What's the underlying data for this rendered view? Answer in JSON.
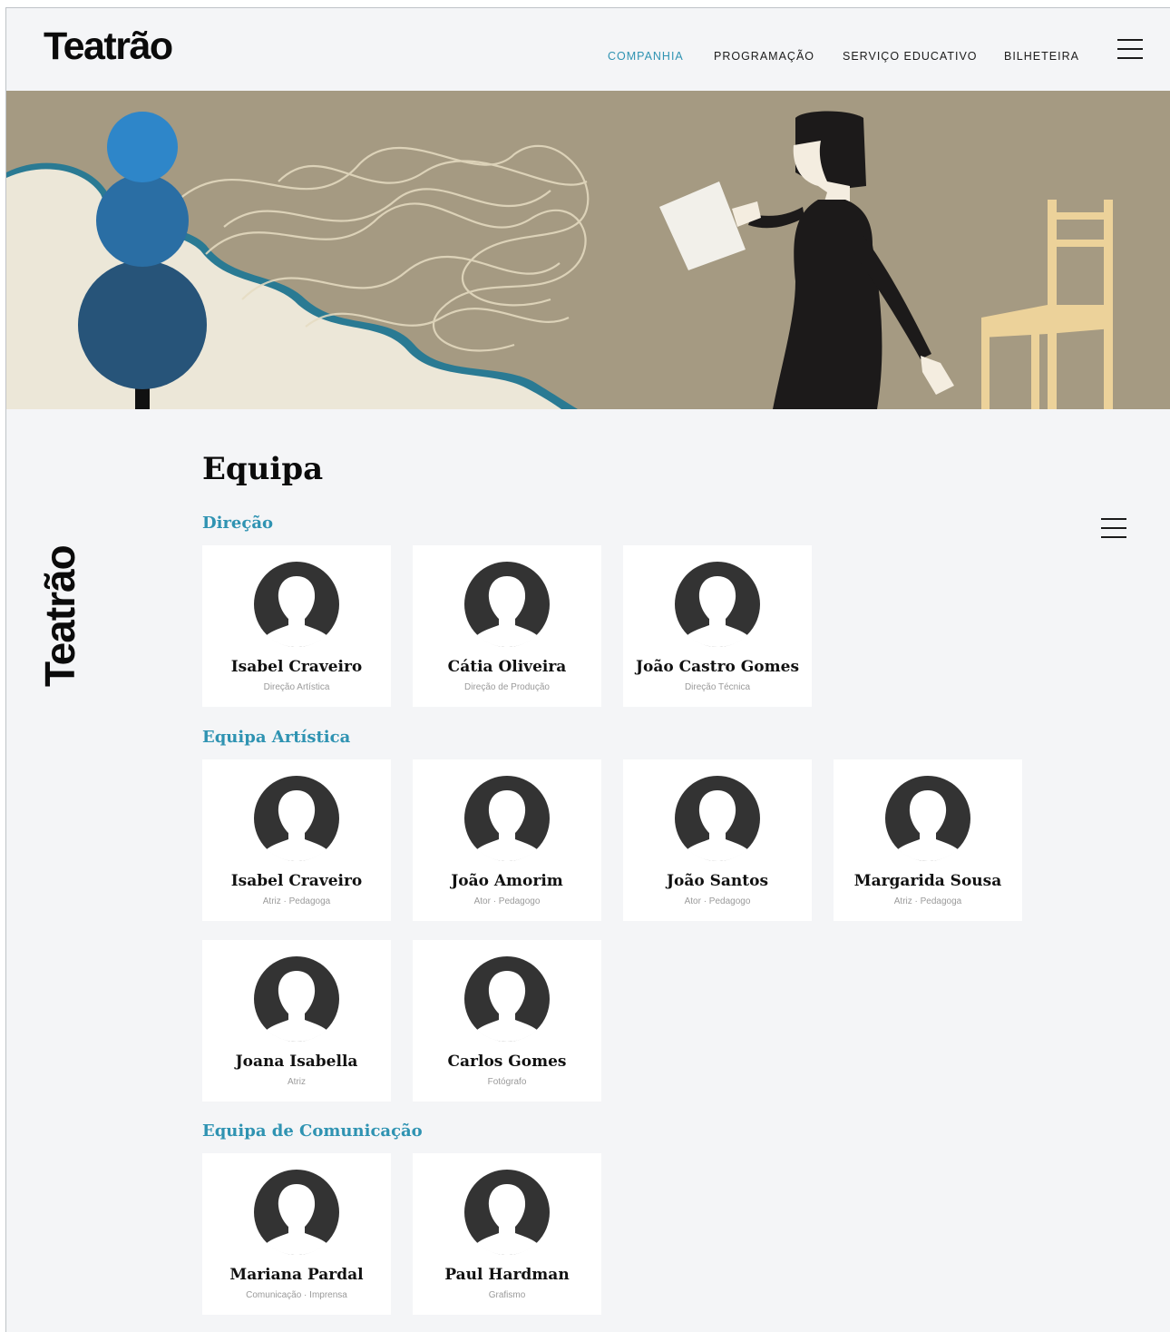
{
  "brand": {
    "logo_text": "Teatrão",
    "vertical_text": "Teatrão"
  },
  "nav": {
    "items": [
      {
        "label": "COMPANHIA",
        "active": true
      },
      {
        "label": "PROGRAMAÇÃO",
        "active": false
      },
      {
        "label": "SERVIÇO EDUCATIVO",
        "active": false
      },
      {
        "label": "BILHETEIRA",
        "active": false
      }
    ],
    "menu_icon": "hamburger-icon"
  },
  "colors": {
    "accent": "#2f93b2",
    "background": "#f4f5f7",
    "hero": "#a59a82",
    "avatar": "#333333"
  },
  "page": {
    "title": "Equipa",
    "side_menu_icon": "hamburger-icon"
  },
  "sections": [
    {
      "title": "Direção",
      "members": [
        {
          "name": "Isabel Craveiro",
          "role": "Direção Artística"
        },
        {
          "name": "Cátia Oliveira",
          "role": "Direção de Produção"
        },
        {
          "name": "João Castro Gomes",
          "role": "Direção Técnica"
        }
      ]
    },
    {
      "title": "Equipa Artística",
      "members": [
        {
          "name": "Isabel Craveiro",
          "role": "Atriz · Pedagoga"
        },
        {
          "name": "João Amorim",
          "role": "Ator · Pedagogo"
        },
        {
          "name": "João Santos",
          "role": "Ator · Pedagogo"
        },
        {
          "name": "Margarida Sousa",
          "role": "Atriz · Pedagoga"
        },
        {
          "name": "Joana Isabella",
          "role": "Atriz"
        },
        {
          "name": "Carlos Gomes",
          "role": "Fotógrafo"
        }
      ]
    },
    {
      "title": "Equipa de Comunicação",
      "members": [
        {
          "name": "Mariana Pardal",
          "role": "Comunicação · Imprensa"
        },
        {
          "name": "Paul Hardman",
          "role": "Grafismo"
        }
      ]
    }
  ]
}
